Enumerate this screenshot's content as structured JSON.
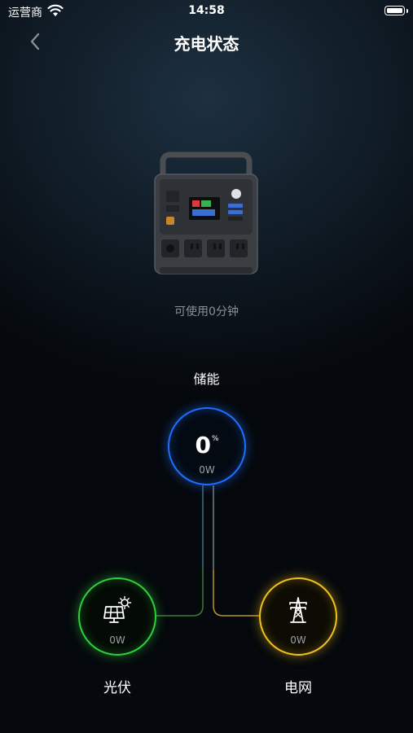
{
  "status_bar": {
    "carrier": "运营商",
    "time": "14:58"
  },
  "nav": {
    "title": "充电状态",
    "back_icon": "chevron-left-icon"
  },
  "device": {
    "image": "portable-power-station",
    "runtime_text": "可使用0分钟"
  },
  "storage": {
    "label": "储能",
    "percent": "0",
    "percent_sign": "%",
    "power": "0W",
    "color": "#1f6fff"
  },
  "solar": {
    "label": "光伏",
    "power": "0W",
    "icon": "solar-panel-icon",
    "color": "#2fcf3a"
  },
  "grid": {
    "label": "电网",
    "power": "0W",
    "icon": "power-tower-icon",
    "color": "#f1c21b"
  }
}
